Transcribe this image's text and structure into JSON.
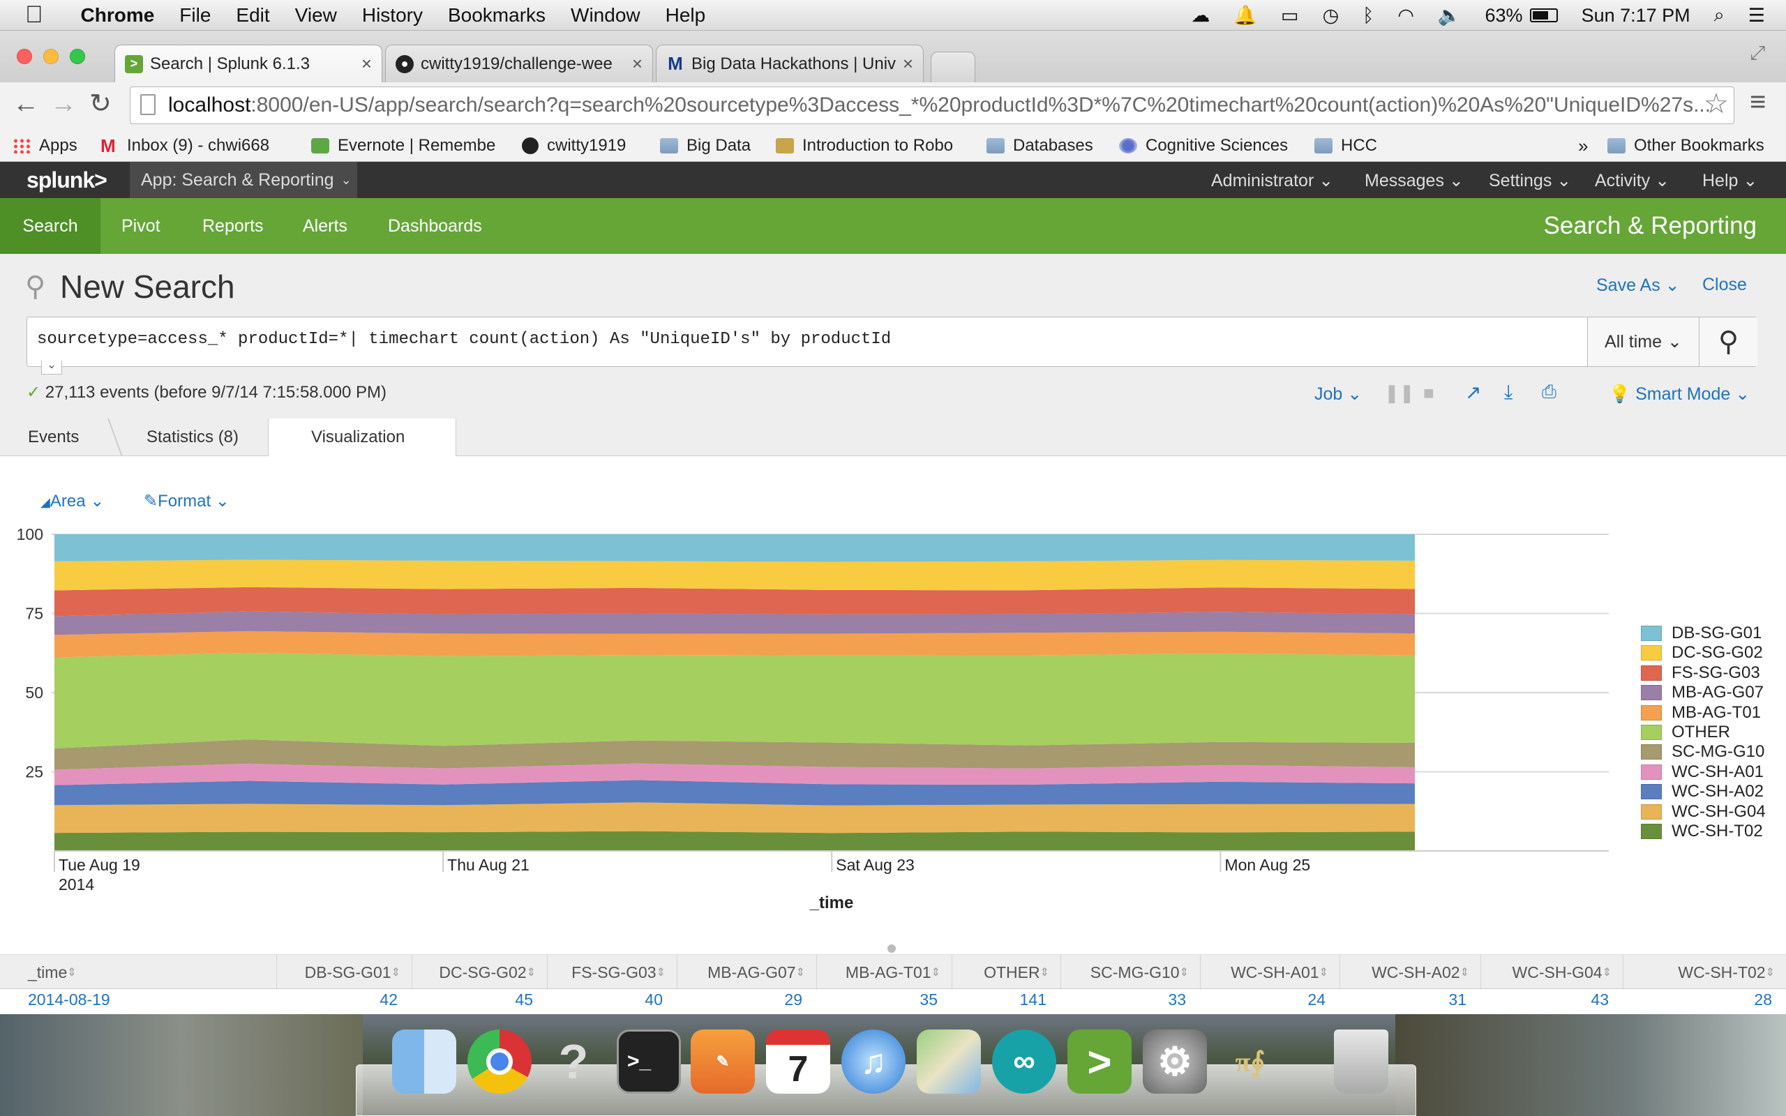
{
  "menubar": {
    "app": "Chrome",
    "items": [
      "File",
      "Edit",
      "View",
      "History",
      "Bookmarks",
      "Window",
      "Help"
    ],
    "battery": "63%",
    "clock": "Sun 7:17 PM"
  },
  "tabs": [
    {
      "title": "Search | Splunk 6.1.3",
      "active": true
    },
    {
      "title": "cwitty1919/challenge-wee",
      "active": false
    },
    {
      "title": "Big Data Hackathons | Univ",
      "active": false
    }
  ],
  "address": {
    "host": "localhost",
    "path": ":8000/en-US/app/search/search?q=search%20sourcetype%3Daccess_*%20productId%3D*%7C%20timechart%20count(action)%20As%20\"UniqueID%27s..."
  },
  "bookmarks": [
    "Apps",
    "Inbox (9) - chwi668",
    "Evernote | Remembe",
    "cwitty1919",
    "Big Data",
    "Introduction to Robo",
    "Databases",
    "Cognitive Sciences",
    "HCC"
  ],
  "bookmarks_more": "»",
  "bookmarks_other": "Other Bookmarks",
  "splunk": {
    "logo": "splunk>",
    "app_label": "App: Search & Reporting",
    "top_menu": [
      "Administrator",
      "Messages",
      "Settings",
      "Activity",
      "Help"
    ],
    "nav": [
      "Search",
      "Pivot",
      "Reports",
      "Alerts",
      "Dashboards"
    ],
    "app_title": "Search & Reporting"
  },
  "search": {
    "page_title": "New Search",
    "save_as": "Save As",
    "close": "Close",
    "query": "sourcetype=access_* productId=*| timechart count(action) As \"UniqueID's\" by productId",
    "time_range": "All time",
    "status": "27,113 events (before 9/7/14 7:15:58.000 PM)",
    "job": "Job",
    "mode": "Smart Mode"
  },
  "result_tabs": [
    "Events",
    "Statistics (8)",
    "Visualization"
  ],
  "viz_controls": {
    "type": "Area",
    "format": "Format"
  },
  "colors": {
    "splunk_green": "#65a637",
    "splunk_dark": "#333333",
    "link_blue": "#1e73be"
  },
  "chart_data": {
    "type": "area",
    "stacking": "100%",
    "x": [
      "2014-08-19",
      "2014-08-20",
      "2014-08-21",
      "2014-08-22",
      "2014-08-23",
      "2014-08-24",
      "2014-08-25",
      "2014-08-26"
    ],
    "x_ticks": [
      {
        "label": "Tue Aug 19",
        "sub": "2014"
      },
      {
        "label": "Thu Aug 21",
        "sub": ""
      },
      {
        "label": "Sat Aug 23",
        "sub": ""
      },
      {
        "label": "Mon Aug 25",
        "sub": ""
      }
    ],
    "xlabel": "_time",
    "ylim": [
      0,
      100
    ],
    "y_ticks": [
      100,
      75,
      50,
      25
    ],
    "legend_position": "right",
    "series": [
      {
        "name": "WC-SH-T02",
        "color": "#6a8f3a",
        "values": [
          28,
          30,
          29,
          31,
          28,
          30,
          29,
          30
        ]
      },
      {
        "name": "WC-SH-G04",
        "color": "#e9b457",
        "values": [
          43,
          44,
          42,
          45,
          43,
          42,
          44,
          43
        ]
      },
      {
        "name": "WC-SH-A02",
        "color": "#5a7ec0",
        "values": [
          31,
          36,
          32,
          35,
          33,
          31,
          35,
          32
        ]
      },
      {
        "name": "WC-SH-A01",
        "color": "#e392be",
        "values": [
          24,
          27,
          25,
          26,
          27,
          25,
          26,
          25
        ]
      },
      {
        "name": "SC-MG-G10",
        "color": "#a69a6e",
        "values": [
          33,
          38,
          35,
          36,
          38,
          36,
          36,
          38
        ]
      },
      {
        "name": "OTHER",
        "color": "#a5cf5f",
        "values": [
          141,
          136,
          139,
          134,
          136,
          140,
          138,
          136
        ]
      },
      {
        "name": "MB-AG-T01",
        "color": "#f4a04e",
        "values": [
          35,
          34,
          35,
          33,
          34,
          35,
          34,
          34
        ]
      },
      {
        "name": "MB-AG-G07",
        "color": "#9a7fa6",
        "values": [
          29,
          31,
          30,
          32,
          30,
          29,
          31,
          30
        ]
      },
      {
        "name": "FS-SG-G03",
        "color": "#df6650",
        "values": [
          40,
          38,
          39,
          40,
          38,
          37,
          38,
          39
        ]
      },
      {
        "name": "DC-SG-G02",
        "color": "#f8cb40",
        "values": [
          45,
          43,
          44,
          42,
          44,
          45,
          43,
          44
        ]
      },
      {
        "name": "DB-SG-G01",
        "color": "#7cc1d4",
        "values": [
          42,
          40,
          41,
          42,
          43,
          42,
          40,
          41
        ]
      }
    ]
  },
  "table": {
    "columns": [
      "_time",
      "DB-SG-G01",
      "DC-SG-G02",
      "FS-SG-G03",
      "MB-AG-G07",
      "MB-AG-T01",
      "OTHER",
      "SC-MG-G10",
      "WC-SH-A01",
      "WC-SH-A02",
      "WC-SH-G04",
      "WC-SH-T02"
    ],
    "row": [
      "2014-08-19",
      "42",
      "45",
      "40",
      "29",
      "35",
      "141",
      "33",
      "24",
      "31",
      "43",
      "28"
    ]
  }
}
